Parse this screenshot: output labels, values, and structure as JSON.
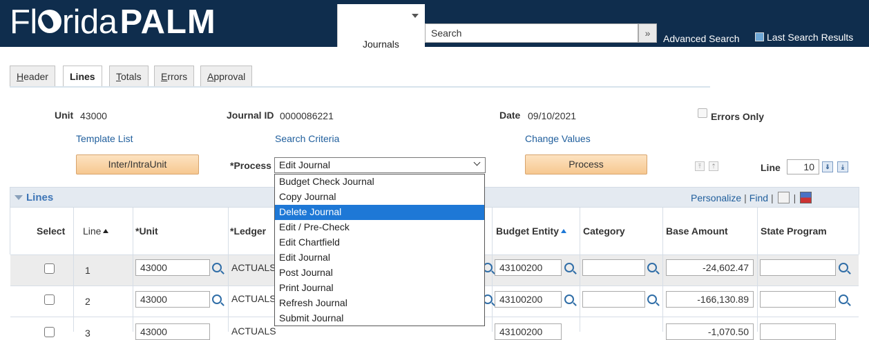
{
  "header": {
    "brand_light": "Fl",
    "brand_light2": "rida",
    "brand_bold": "PALM",
    "menu_label": "Journals",
    "search_placeholder": "Search",
    "search_go": "»",
    "advanced_search": "Advanced Search",
    "last_search_results": "Last Search Results"
  },
  "tabs": [
    {
      "pre": "",
      "u": "H",
      "post": "eader"
    },
    {
      "pre": "",
      "u": "",
      "post": "Lines",
      "active": true
    },
    {
      "pre": "",
      "u": "T",
      "post": "otals"
    },
    {
      "pre": "",
      "u": "E",
      "post": "rrors"
    },
    {
      "pre": "",
      "u": "A",
      "post": "pproval"
    }
  ],
  "form": {
    "unit_label": "Unit",
    "unit_value": "43000",
    "journal_id_label": "Journal ID",
    "journal_id_value": "0000086221",
    "date_label": "Date",
    "date_value": "09/10/2021",
    "errors_only_label": "Errors Only",
    "template_list": "Template List",
    "search_criteria": "Search Criteria",
    "change_values": "Change Values",
    "inter_intra_button": "Inter/IntraUnit",
    "process_label": "*Process",
    "process_value": "Edit Journal",
    "process_button": "Process",
    "line_label": "Line",
    "line_value": "10"
  },
  "process_options": [
    "Budget Check Journal",
    "Copy Journal",
    "Delete Journal",
    "Edit / Pre-Check",
    "Edit Chartfield",
    "Edit Journal",
    "Post Journal",
    "Print Journal",
    "Refresh Journal",
    "Submit Journal"
  ],
  "process_highlighted": "Delete Journal",
  "grid": {
    "title": "Lines",
    "personalize": "Personalize",
    "find": "Find",
    "columns": {
      "select": "Select",
      "line": "Line",
      "unit": "*Unit",
      "ledger": "*Ledger",
      "budget_entity": "Budget Entity",
      "category": "Category",
      "base_amount": "Base Amount",
      "state_program": "State Program"
    },
    "rows": [
      {
        "line": "1",
        "unit": "43000",
        "ledger": "ACTUALS",
        "budget_entity": "43100200",
        "category": "",
        "base_amount": "-24,602.47",
        "state_program": ""
      },
      {
        "line": "2",
        "unit": "43000",
        "ledger": "ACTUALS",
        "budget_entity": "43100200",
        "category": "",
        "base_amount": "-166,130.89",
        "state_program": ""
      },
      {
        "line": "3",
        "unit": "43000",
        "ledger": "ACTUALS",
        "budget_entity": "43100200",
        "category": "",
        "base_amount": "-1,070.50",
        "state_program": ""
      }
    ]
  },
  "colors": {
    "header_bg": "#0f2d4d",
    "link": "#1f5e9c",
    "selected_option": "#1e78d6",
    "orange_button": "#f6c890"
  }
}
